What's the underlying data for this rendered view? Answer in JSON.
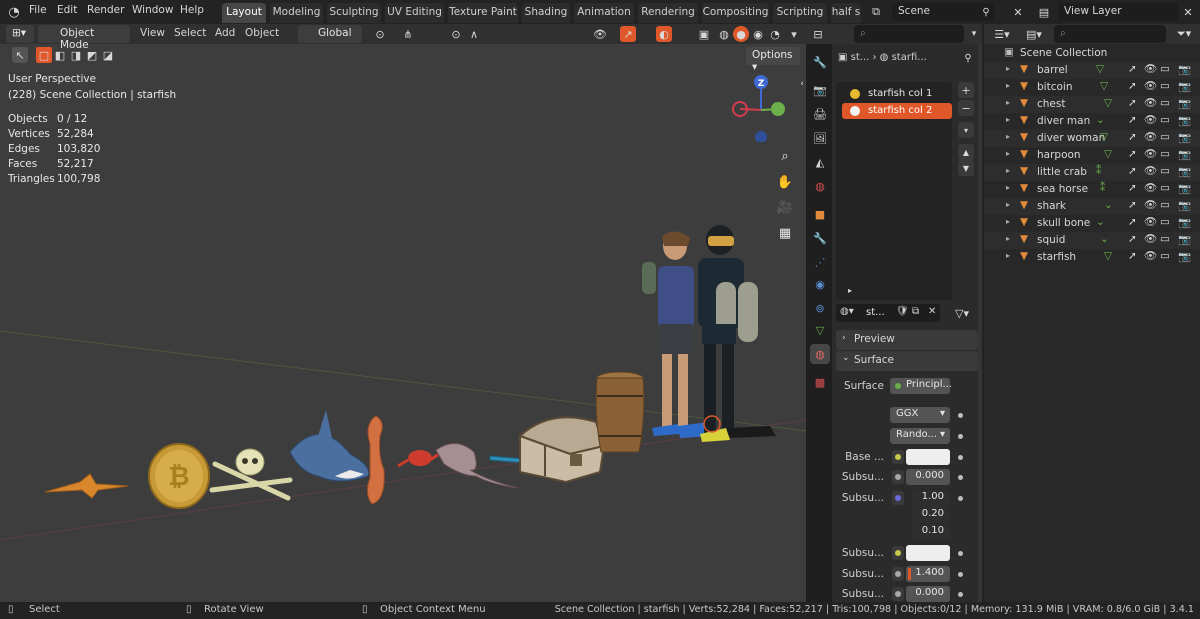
{
  "topbar": {
    "menus": [
      "File",
      "Edit",
      "Render",
      "Window",
      "Help"
    ],
    "workspace_tabs": [
      "Layout",
      "Modeling",
      "Sculpting",
      "UV Editing",
      "Texture Paint",
      "Shading",
      "Animation",
      "Rendering",
      "Compositing",
      "Scripting",
      "half s"
    ],
    "active_tab": "Layout",
    "scene_name": "Scene",
    "view_layer": "View Layer"
  },
  "viewport_header": {
    "mode": "Object Mode",
    "menus": [
      "View",
      "Select",
      "Add",
      "Object"
    ],
    "transform_orientation": "Global",
    "options_label": "Options"
  },
  "viewport_overlay": {
    "perspective": "User Perspective",
    "collection_line": "(228) Scene Collection | starfish",
    "stats": [
      {
        "label": "Objects",
        "value": "0 / 12"
      },
      {
        "label": "Vertices",
        "value": "52,284"
      },
      {
        "label": "Edges",
        "value": "103,820"
      },
      {
        "label": "Faces",
        "value": "52,217"
      },
      {
        "label": "Triangles",
        "value": "100,798"
      }
    ],
    "gizmo_axis": "Z"
  },
  "properties": {
    "breadcrumb_short": "st...",
    "breadcrumb_object": "starfi...",
    "material_slots": [
      {
        "name": "starfish col 1",
        "selected": false,
        "color": "#e6b82e"
      },
      {
        "name": "starfish col 2",
        "selected": true,
        "color": "#f4f4f4"
      }
    ],
    "material_name": "st...",
    "preview_label": "Preview",
    "surface_panel_label": "Surface",
    "surface_label": "Surface",
    "surface_shader": "Principl...",
    "distribution": "GGX",
    "subsurface_method": "Rando...",
    "rows": [
      {
        "label": "Base ...",
        "value": ""
      },
      {
        "label": "Subsu...",
        "value": "0.000"
      },
      {
        "label": "Subsu...",
        "value": "1.00"
      },
      {
        "label": "",
        "value": "0.20"
      },
      {
        "label": "",
        "value": "0.10"
      },
      {
        "label": "Subsu...",
        "value": ""
      },
      {
        "label": "Subsu...",
        "value": "1.400"
      },
      {
        "label": "Subsu...",
        "value": "0.000"
      }
    ]
  },
  "outliner": {
    "root": "Scene Collection",
    "items": [
      "barrel",
      "bitcoin",
      "chest",
      "diver man",
      "diver woman",
      "harpoon",
      "little crab",
      "sea horse",
      "shark",
      "skull bone",
      "squid",
      "starfish"
    ]
  },
  "statusbar": {
    "select": "Select",
    "rotate": "Rotate View",
    "context": "Object Context Menu",
    "info": "Scene Collection | starfish | Verts:52,284 | Faces:52,217 | Tris:100,798 | Objects:0/12 | Memory: 131.9 MiB | VRAM: 0.8/6.0 GiB | 3.4.1"
  },
  "colors": {
    "accent": "#e0582a",
    "x_axis": "#d43c4c",
    "y_axis": "#6bb04b",
    "z_axis": "#3f6ad6"
  }
}
